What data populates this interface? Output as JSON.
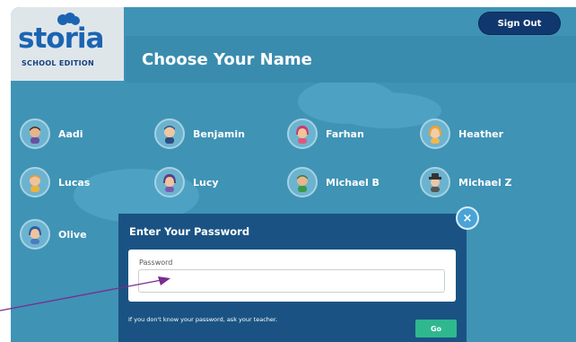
{
  "app": {
    "logo_word": "storia",
    "logo_subtitle": "SCHOOL EDITION",
    "page_title": "Choose Your Name",
    "sign_out_label": "Sign Out"
  },
  "students": [
    {
      "name": "Aadi",
      "icon": "boy-avatar-icon"
    },
    {
      "name": "Benjamin",
      "icon": "boy-avatar-icon"
    },
    {
      "name": "Farhan",
      "icon": "girl-avatar-icon"
    },
    {
      "name": "Heather",
      "icon": "girl-avatar-icon"
    },
    {
      "name": "Lucas",
      "icon": "boy-avatar-icon"
    },
    {
      "name": "Lucy",
      "icon": "girl-avatar-icon"
    },
    {
      "name": "Michael B",
      "icon": "boy-avatar-icon"
    },
    {
      "name": "Michael Z",
      "icon": "detective-avatar-icon"
    },
    {
      "name": "Olive",
      "icon": "girl-avatar-icon"
    }
  ],
  "modal": {
    "title": "Enter Your Password",
    "field_label": "Password",
    "field_value": "",
    "hint": "If you don't know your password, ask your teacher.",
    "go_label": "Go",
    "close_label": "×"
  },
  "colors": {
    "background": "#3f93b5",
    "header": "#3a8cae",
    "modal": "#1a5383",
    "button_dark": "#11386e",
    "go_button": "#2fb88e",
    "close_button": "#4aa3d6",
    "logo": "#1b64b2",
    "arrow": "#7a2b8f"
  }
}
